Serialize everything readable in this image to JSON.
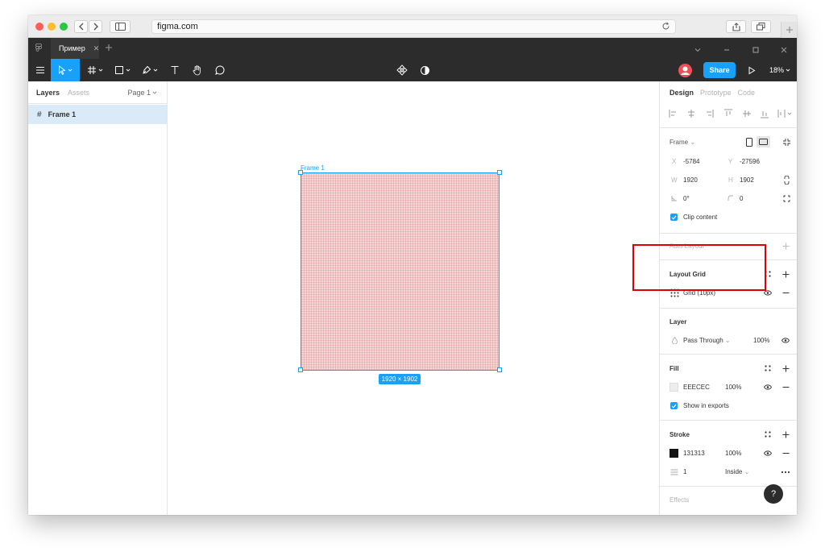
{
  "browser": {
    "url": "figma.com"
  },
  "figma": {
    "tab_title": "Пример",
    "share_label": "Share",
    "zoom": "18%"
  },
  "left_panel": {
    "tabs": [
      "Layers",
      "Assets"
    ],
    "page_selector": "Page 1",
    "layers": [
      {
        "name": "Frame 1"
      }
    ]
  },
  "canvas": {
    "frame_label": "Frame 1",
    "frame_size": "1920 × 1902"
  },
  "right_panel": {
    "tabs": [
      "Design",
      "Prototype",
      "Code"
    ],
    "frame": {
      "type": "Frame",
      "x_label": "X",
      "x": "-5784",
      "y_label": "Y",
      "y": "-27596",
      "w_label": "W",
      "w": "1920",
      "h_label": "H",
      "h": "1902",
      "rotation": "0°",
      "radius": "0",
      "clip_content": "Clip content"
    },
    "auto_layout": "Auto Layout",
    "layout_grid": {
      "title": "Layout Grid",
      "item": "Grid (10px)"
    },
    "layer": {
      "title": "Layer",
      "blend_mode": "Pass Through",
      "opacity": "100%"
    },
    "fill": {
      "title": "Fill",
      "hex": "EEECEC",
      "opacity": "100%",
      "swatch_color": "#eeecec",
      "show_in_exports": "Show in exports"
    },
    "stroke": {
      "title": "Stroke",
      "hex": "131313",
      "opacity": "100%",
      "swatch_color": "#131313",
      "weight": "1",
      "position": "Inside"
    },
    "effects": "Effects"
  },
  "help_label": "?",
  "colors": {
    "accent": "#18a0fb",
    "highlight": "#e00000",
    "toolbar_bg": "#2c2c2c"
  }
}
